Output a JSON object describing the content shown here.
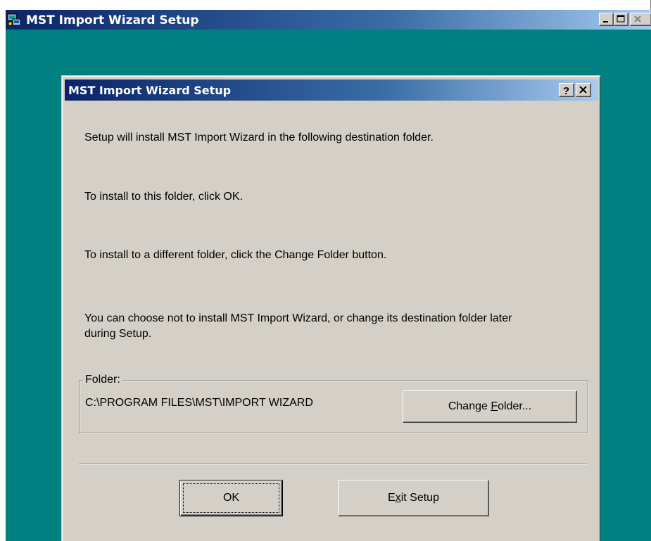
{
  "outer_window": {
    "title": "MST Import Wizard Setup"
  },
  "dialog": {
    "title": "MST Import Wizard Setup",
    "messages": [
      "Setup will install MST Import Wizard in the following destination folder.",
      "To install to this folder, click OK.",
      "To install to a different folder, click the Change Folder button.",
      "You can choose not to install MST Import Wizard, or change its destination folder later",
      "during Setup."
    ],
    "folder_group": {
      "label": "Folder:",
      "path": "C:\\PROGRAM FILES\\MST\\IMPORT WIZARD",
      "change_button": {
        "before": "Change ",
        "mnemonic": "F",
        "after": "older..."
      }
    },
    "ok_button": "OK",
    "exit_button": {
      "before": "E",
      "mnemonic": "x",
      "after": "it Setup"
    }
  },
  "colors": {
    "desktop": "#008080",
    "title_bar_start": "#0a246a",
    "title_bar_end": "#a6caf0",
    "face": "#d4d0c8"
  },
  "icons": {
    "app": "setup-computer-icon",
    "minimize": "minimize-icon",
    "maximize": "maximize-icon",
    "close": "close-icon",
    "help": "help-icon"
  }
}
